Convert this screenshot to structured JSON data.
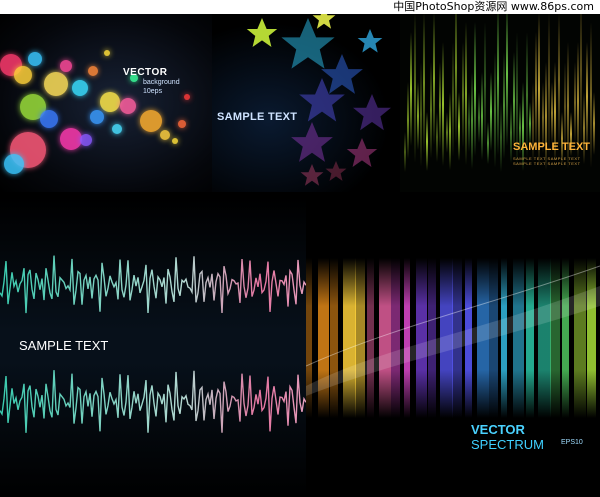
{
  "watermark": "中国PhotoShop资源网 www.86ps.com",
  "panel1": {
    "title": "VECTOR",
    "line1": "background",
    "line2": "10eps"
  },
  "panel2": {
    "text": "SAMPLE TEXT"
  },
  "panel3": {
    "text": "SAMPLE TEXT",
    "small": "SAMPLE TEXT   SAMPLE TEXT   SAMPLE TEXT   SAMPLE TEXT"
  },
  "panel4": {
    "text": "SAMPLE TEXT"
  },
  "panel5": {
    "title_a": "VECTOR",
    "title_b": " SPECTRUM",
    "eps": "EPS10"
  },
  "colors": {
    "bg": "#000000",
    "accent_orange": "#ffb43a",
    "accent_blue": "#3fd0ff"
  }
}
